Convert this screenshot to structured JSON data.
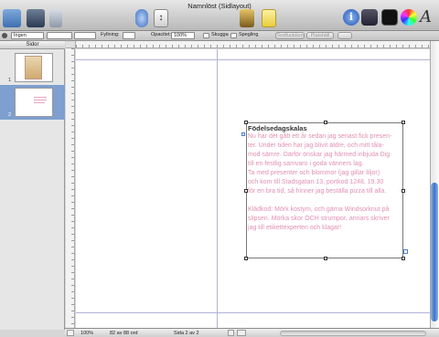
{
  "window": {
    "title": "Namnlöst (Sidlayout)"
  },
  "format_bar": {
    "style_value": "Ingen",
    "fill_label": "Fyllning:",
    "opacity_label": "Opacitet:",
    "opacity_value": "100%",
    "shadow_label": "Skugga",
    "reflection_label": "Spegling",
    "text_button": "Textfunktion",
    "placeholder_button": "Platshåll"
  },
  "sidebar": {
    "header": "Sidor",
    "pages": [
      {
        "number": "1"
      },
      {
        "number": "2"
      }
    ]
  },
  "document": {
    "title": "Födelsedagskalas",
    "lines": [
      "Nu har det gått ett år sedan jag senast fick presen-",
      "ter. Under tiden har jag blivit äldre, och mitt tåla-",
      "mod sämre. Därför önskar jag härmed inbjuda Dig",
      "till en festlig samvaro i goda vänners lag.",
      "Ta med presenter och blommor (jag gillar liljor)",
      "och kom till Stadsgatan 13, portkod 1248, 19.30",
      "för en bra tid, så hinner jag beställa pizza till alla.",
      "",
      "Klädkod: Mörk kostym, och gärna Windsorknut på",
      "slipsen. Mörka skor OCH strumpor, annars skriver",
      "jag till etikettexperten och klagar!"
    ]
  },
  "status": {
    "zoom": "100%",
    "word_count": "82 av 88 ord",
    "page_info": "Sida 2 av 2"
  },
  "colors": {
    "accent_text": "#e28fb2",
    "selection": "#3b73c9"
  }
}
